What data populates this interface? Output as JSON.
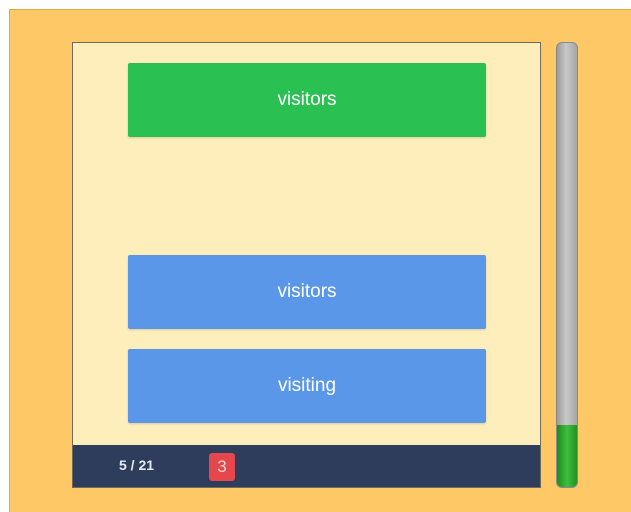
{
  "game": {
    "tiles": [
      {
        "label": "visitors",
        "color": "#2bc152",
        "state": "correct"
      },
      {
        "label": "visitors",
        "color": "#5b97e8",
        "state": "option"
      },
      {
        "label": "visiting",
        "color": "#5b97e8",
        "state": "option"
      }
    ],
    "footer": {
      "progress_text": "5 / 21",
      "lives": "3"
    },
    "timer": {
      "level_fraction": 0.14,
      "fill_color": "#2aa52a"
    }
  }
}
